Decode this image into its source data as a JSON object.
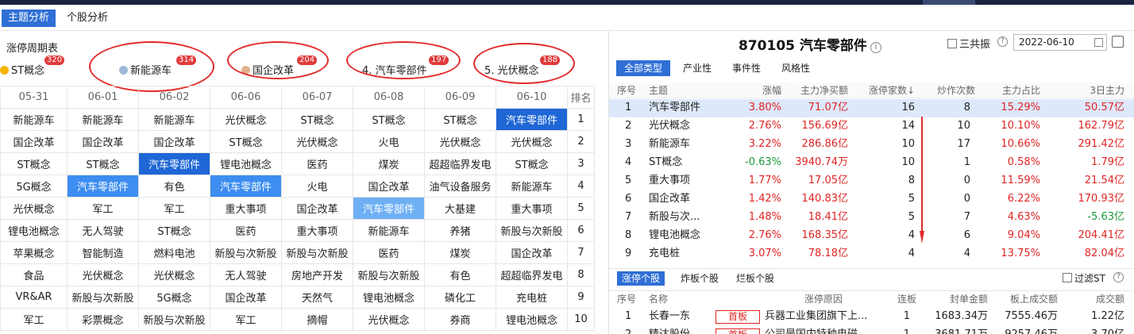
{
  "nav": {
    "tabs": [
      {
        "label": "主题分析",
        "active": true
      },
      {
        "label": "个股分析",
        "active": false
      }
    ]
  },
  "left": {
    "title": "涨停周期表",
    "topics": [
      {
        "label": "ST概念",
        "badge": "320",
        "icon_color": "#f5b400"
      },
      {
        "label": "新能源车",
        "badge": "314",
        "icon_color": "#9fb8d8"
      },
      {
        "label": "国企改革",
        "badge": "204",
        "icon_color": "#e3b08a"
      },
      {
        "label": "4. 汽车零部件",
        "badge": "197",
        "icon_color": ""
      },
      {
        "label": "5. 光伏概念",
        "badge": "188",
        "icon_color": ""
      }
    ],
    "columns": [
      "05-31",
      "06-01",
      "06-02",
      "06-06",
      "06-07",
      "06-08",
      "06-09",
      "06-10",
      "排名"
    ],
    "rows": [
      [
        "新能源车",
        "新能源车",
        "新能源车",
        "光伏概念",
        "ST概念",
        "ST概念",
        "ST概念",
        "汽车零部件",
        "1"
      ],
      [
        "国企改革",
        "国企改革",
        "国企改革",
        "ST概念",
        "光伏概念",
        "火电",
        "光伏概念",
        "光伏概念",
        "2"
      ],
      [
        "ST概念",
        "ST概念",
        "汽车零部件",
        "锂电池概念",
        "医药",
        "煤炭",
        "超超临界发电",
        "ST概念",
        "3"
      ],
      [
        "5G概念",
        "汽车零部件",
        "有色",
        "汽车零部件",
        "火电",
        "国企改革",
        "油气设备服务",
        "新能源车",
        "4"
      ],
      [
        "光伏概念",
        "军工",
        "军工",
        "重大事项",
        "国企改革",
        "汽车零部件",
        "大基建",
        "重大事项",
        "5"
      ],
      [
        "锂电池概念",
        "无人驾驶",
        "ST概念",
        "医药",
        "重大事项",
        "新能源车",
        "养猪",
        "新股与次新股",
        "6"
      ],
      [
        "苹果概念",
        "智能制造",
        "燃料电池",
        "新股与次新股",
        "新股与次新股",
        "医药",
        "煤炭",
        "国企改革",
        "7"
      ],
      [
        "食品",
        "光伏概念",
        "光伏概念",
        "无人驾驶",
        "房地产开发",
        "新股与次新股",
        "有色",
        "超超临界发电",
        "8"
      ],
      [
        "VR&AR",
        "新股与次新股",
        "5G概念",
        "国企改革",
        "天然气",
        "锂电池概念",
        "磷化工",
        "充电桩",
        "9"
      ],
      [
        "军工",
        "彩票概念",
        "新股与次新股",
        "军工",
        "摘帽",
        "光伏概念",
        "券商",
        "锂电池概念",
        "10"
      ]
    ]
  },
  "right": {
    "title": "870105 汽车零部件",
    "sanguo_label": "三共振",
    "date": "2022-06-10",
    "tabs": [
      "全部类型",
      "产业性",
      "事件性",
      "风格性"
    ],
    "headers": [
      "序号",
      "主题",
      "涨幅",
      "主力净买额",
      "涨停家数↓",
      "炒作次数",
      "主力占比",
      "3日主力"
    ],
    "rows": [
      {
        "no": "1",
        "topic": "汽车零部件",
        "pct": "3.80%",
        "net": "71.07亿",
        "limit": "16",
        "hype": "8",
        "ratio": "15.29%",
        "d3": "50.57亿",
        "pct_dir": "up",
        "d3_dir": "up"
      },
      {
        "no": "2",
        "topic": "光伏概念",
        "pct": "2.76%",
        "net": "156.69亿",
        "limit": "14",
        "hype": "10",
        "ratio": "10.10%",
        "d3": "162.79亿",
        "pct_dir": "up",
        "d3_dir": "up"
      },
      {
        "no": "3",
        "topic": "新能源车",
        "pct": "3.22%",
        "net": "286.86亿",
        "limit": "10",
        "hype": "17",
        "ratio": "10.66%",
        "d3": "291.42亿",
        "pct_dir": "up",
        "d3_dir": "up"
      },
      {
        "no": "4",
        "topic": "ST概念",
        "pct": "-0.63%",
        "net": "3940.74万",
        "limit": "10",
        "hype": "1",
        "ratio": "0.58%",
        "d3": "1.79亿",
        "pct_dir": "down",
        "d3_dir": "up"
      },
      {
        "no": "5",
        "topic": "重大事项",
        "pct": "1.77%",
        "net": "17.05亿",
        "limit": "8",
        "hype": "0",
        "ratio": "11.59%",
        "d3": "21.54亿",
        "pct_dir": "up",
        "d3_dir": "up"
      },
      {
        "no": "6",
        "topic": "国企改革",
        "pct": "1.42%",
        "net": "140.83亿",
        "limit": "5",
        "hype": "0",
        "ratio": "6.22%",
        "d3": "170.93亿",
        "pct_dir": "up",
        "d3_dir": "up"
      },
      {
        "no": "7",
        "topic": "新股与次...",
        "pct": "1.48%",
        "net": "18.41亿",
        "limit": "5",
        "hype": "7",
        "ratio": "4.63%",
        "d3": "-5.63亿",
        "pct_dir": "up",
        "d3_dir": "down"
      },
      {
        "no": "8",
        "topic": "锂电池概念",
        "pct": "2.76%",
        "net": "168.35亿",
        "limit": "4",
        "hype": "6",
        "ratio": "9.04%",
        "d3": "204.41亿",
        "pct_dir": "up",
        "d3_dir": "up"
      },
      {
        "no": "9",
        "topic": "充电桩",
        "pct": "3.07%",
        "net": "78.18亿",
        "limit": "4",
        "hype": "4",
        "ratio": "13.75%",
        "d3": "82.04亿",
        "pct_dir": "up",
        "d3_dir": "up"
      }
    ],
    "bottom_tabs": [
      "涨停个股",
      "炸板个股",
      "烂板个股"
    ],
    "filter_label": "过滤ST",
    "bottom_headers": [
      "序号",
      "名称",
      "涨停原因",
      "连板",
      "封单金额",
      "板上成交额",
      "成交额"
    ],
    "bottom_rows": [
      {
        "no": "1",
        "name": "长春一东",
        "tag": "首板",
        "reason": "兵器工业集团旗下上...",
        "lianban": "1",
        "seal": "1683.34万",
        "board_amt": "7555.46万",
        "amount": "1.22亿"
      },
      {
        "no": "2",
        "name": "精达股份",
        "tag": "首板",
        "reason": "公司是国内特种电磁...",
        "lianban": "1",
        "seal": "3681.71万",
        "board_amt": "9257.46万",
        "amount": "3.70亿"
      }
    ]
  },
  "colors": {
    "accent": "#2f6fd6",
    "up": "#e02424",
    "down": "#1a9a3c",
    "highlight_dark": "#1f67d6",
    "highlight_mid": "#3d8ef0",
    "highlight_light": "#6fb0f5",
    "annotation": "#e32b2b"
  }
}
